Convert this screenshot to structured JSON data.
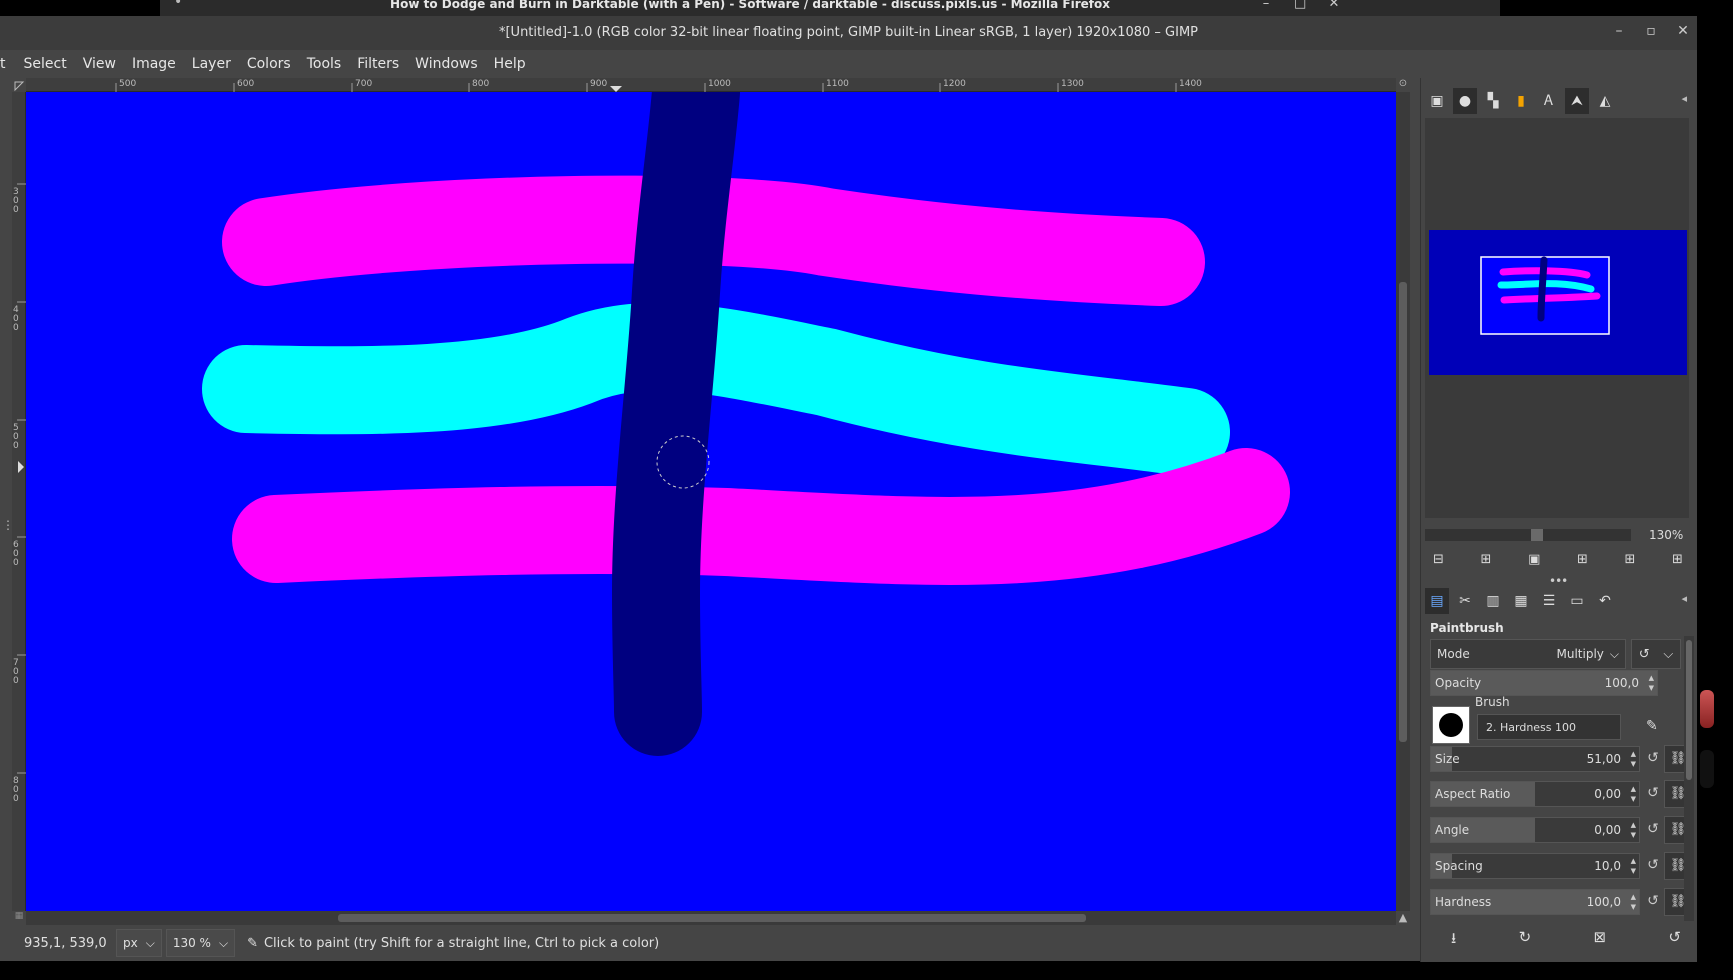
{
  "firefox": {
    "title": "How to Dodge and Burn in Darktable (with a Pen) - Software / darktable - discuss.pixls.us - Mozilla Firefox",
    "minimize": "–",
    "maximize": "□",
    "close": "✕"
  },
  "window": {
    "title": "*[Untitled]-1.0 (RGB color 32-bit linear floating point, GIMP built-in Linear sRGB, 1 layer) 1920x1080 – GIMP",
    "minimize": "–",
    "maximize": "▫",
    "close": "✕"
  },
  "menu": [
    "t",
    "Select",
    "View",
    "Image",
    "Layer",
    "Colors",
    "Tools",
    "Filters",
    "Windows",
    "Help"
  ],
  "ruler": {
    "horizontal": [
      "500",
      "600",
      "700",
      "800",
      "900",
      "1000",
      "1100",
      "1200",
      "1300",
      "1400"
    ],
    "vertical": [
      "300",
      "400",
      "500",
      "600",
      "700",
      "800"
    ]
  },
  "canvas": {
    "background": "#0000ff",
    "colors": {
      "magenta": "#ff00ff",
      "cyan": "#00ffff",
      "dark_blue": "#000080"
    }
  },
  "statusbar": {
    "coords": "935,1, 539,0",
    "unit": "px",
    "zoom": "130 %",
    "message": "Click to paint (try Shift for a straight line, Ctrl to pick a color)"
  },
  "navigator": {
    "zoom": "130%"
  },
  "tool_options": {
    "title": "Paintbrush",
    "mode_label": "Mode",
    "mode_value": "Multiply",
    "opacity_label": "Opacity",
    "opacity_value": "100,0",
    "brush_label": "Brush",
    "brush_name": "2. Hardness 100",
    "size_label": "Size",
    "size_value": "51,00",
    "aspect_label": "Aspect Ratio",
    "aspect_value": "0,00",
    "angle_label": "Angle",
    "angle_value": "0,00",
    "spacing_label": "Spacing",
    "spacing_value": "10,0",
    "hardness_label": "Hardness",
    "hardness_value": "100,0"
  },
  "fills": {
    "opacity": 1.0,
    "size": 0.1,
    "aspect": 0.5,
    "angle": 0.5,
    "spacing": 0.1,
    "hardness": 1.0
  }
}
